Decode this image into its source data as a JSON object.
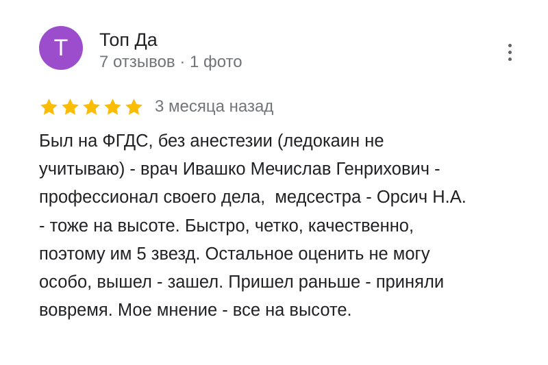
{
  "author": {
    "avatar_letter": "T",
    "avatar_color": "#9c4dcc",
    "name": "Топ Да",
    "meta": "7 отзывов · 1 фото"
  },
  "menu": {
    "icon": "more-vert-icon"
  },
  "review": {
    "rating": 5,
    "max_rating": 5,
    "star_color": "#fbbc04",
    "date": "3 месяца назад",
    "text": "Был на ФГДС, без анестезии (ледокаин не\nучитываю) - врач Ивашко Мечислав Генрихович -\nпрофессионал своего дела,  медсестра - Орсич Н.А.\n- тоже на высоте. Быстро, четко, качественно,\nпоэтому им 5 звезд. Остальное оценить не могу\nособо, вышел - зашел. Пришел раньше - приняли\nвовремя. Мое мнение - все на высоте."
  }
}
